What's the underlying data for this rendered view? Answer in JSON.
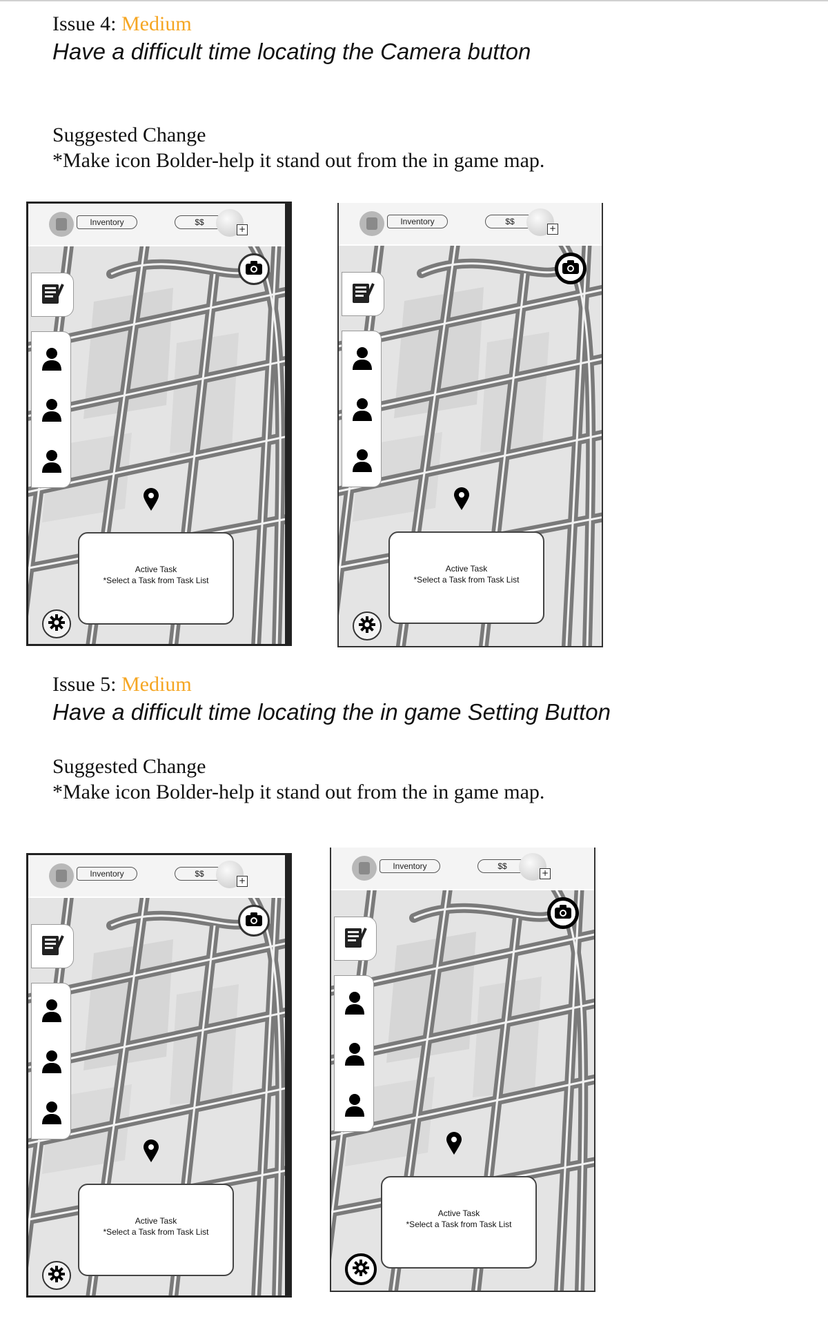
{
  "issue4": {
    "label": "Issue 4: ",
    "severity": "Medium",
    "description": "Have a difficult time locating the Camera button",
    "suggested_heading": "Suggested Change",
    "suggested_text": "*Make icon Bolder-help it stand out from the in game map."
  },
  "issue5": {
    "label": "Issue 5: ",
    "severity": "Medium",
    "description": "Have a difficult time locating the in game Setting Button",
    "suggested_heading": "Suggested Change",
    "suggested_text": "*Make icon Bolder-help it stand out from the in game map."
  },
  "mockup": {
    "inventory_label": "Inventory",
    "money_label": "$$",
    "plus_label": "+",
    "task_title": "Active Task",
    "task_hint": "*Select a Task from Task List"
  },
  "colors": {
    "severity": "#f5a623",
    "map": "#e4e4e4",
    "road": "#7a7a7a"
  },
  "icons": [
    "inventory-bag-icon",
    "coin-icon",
    "plus-icon",
    "camera-icon",
    "task-list-icon",
    "person-icon",
    "location-pin-icon",
    "settings-gear-icon"
  ]
}
